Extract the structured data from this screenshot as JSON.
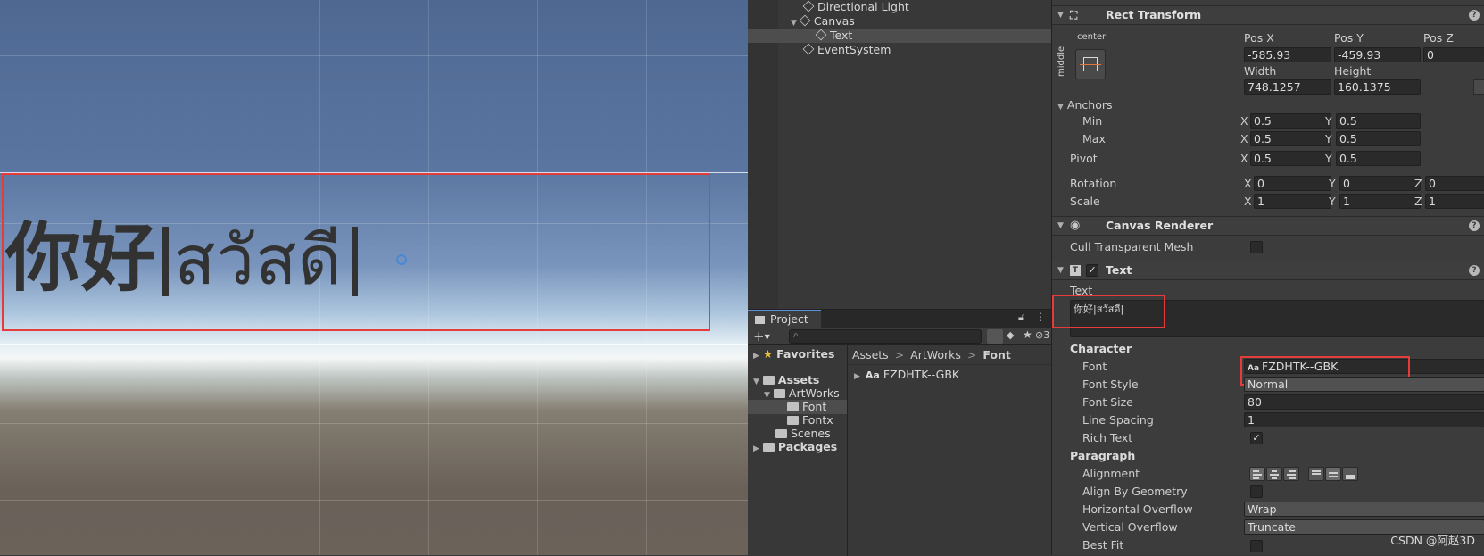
{
  "hierarchy": {
    "items": [
      "Directional Light",
      "Canvas",
      "Text",
      "EventSystem"
    ]
  },
  "scene": {
    "text_cjk": "你好",
    "text_thai": "สวัสดี"
  },
  "project": {
    "tab_label": "Project",
    "hidden_count": "3",
    "favorites": "Favorites",
    "assets": "Assets",
    "folders": [
      "ArtWorks",
      "Font",
      "Fontx",
      "Scenes"
    ],
    "packages": "Packages",
    "breadcrumb": [
      "Assets",
      "ArtWorks",
      "Font"
    ],
    "breadcrumb_sep": ">",
    "files": [
      {
        "icon": "Aa",
        "name": "FZDHTK--GBK"
      }
    ]
  },
  "inspector": {
    "rect_transform": {
      "title": "Rect Transform",
      "anchor_preset_top": "center",
      "anchor_preset_side": "middle",
      "pos_x_label": "Pos X",
      "pos_y_label": "Pos Y",
      "pos_z_label": "Pos Z",
      "pos_x": "-585.93",
      "pos_y": "-459.93",
      "pos_z": "0",
      "width_label": "Width",
      "height_label": "Height",
      "width": "748.1257",
      "height": "160.1375",
      "anchors_label": "Anchors",
      "min_label": "Min",
      "max_label": "Max",
      "min_x": "0.5",
      "min_y": "0.5",
      "max_x": "0.5",
      "max_y": "0.5",
      "pivot_label": "Pivot",
      "pivot_x": "0.5",
      "pivot_y": "0.5",
      "rotation_label": "Rotation",
      "rot_x": "0",
      "rot_y": "0",
      "rot_z": "0",
      "scale_label": "Scale",
      "scale_x": "1",
      "scale_y": "1",
      "scale_z": "1",
      "x": "X",
      "y": "Y",
      "z": "Z"
    },
    "canvas_renderer": {
      "title": "Canvas Renderer",
      "cull_label": "Cull Transparent Mesh"
    },
    "text": {
      "title": "Text",
      "text_label": "Text",
      "text_value": "你好|สวัสดี|",
      "character_label": "Character",
      "font_label": "Font",
      "font_icon": "Aa",
      "font_value": "FZDHTK--GBK",
      "font_style_label": "Font Style",
      "font_style_value": "Normal",
      "font_size_label": "Font Size",
      "font_size_value": "80",
      "line_spacing_label": "Line Spacing",
      "line_spacing_value": "1",
      "rich_text_label": "Rich Text",
      "paragraph_label": "Paragraph",
      "alignment_label": "Alignment",
      "align_by_geometry_label": "Align By Geometry",
      "horizontal_overflow_label": "Horizontal Overflow",
      "horizontal_overflow_value": "Wrap",
      "vertical_overflow_label": "Vertical Overflow",
      "vertical_overflow_value": "Truncate",
      "best_fit_label": "Best Fit"
    }
  },
  "watermark": "CSDN @阿赵3D",
  "colors": {
    "highlight_red": "#e53b3b",
    "selection": "#4d4d4d",
    "accent_blue": "#5a8ed6"
  }
}
